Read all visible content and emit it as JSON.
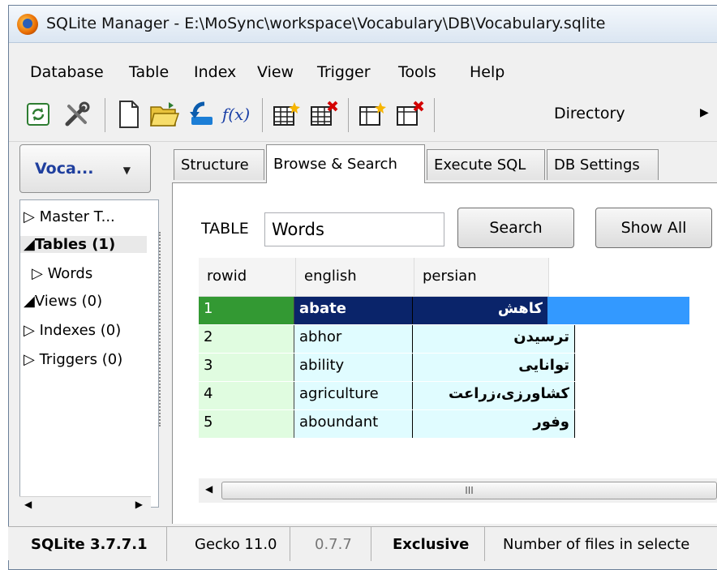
{
  "window": {
    "title": "SQLite Manager - E:\\MoSync\\workspace\\Vocabulary\\DB\\Vocabulary.sqlite"
  },
  "menu": [
    "Database",
    "Table",
    "Index",
    "View",
    "Trigger",
    "Tools",
    "Help"
  ],
  "toolbar": {
    "directory_label": "Directory",
    "fx_label": "f(x)"
  },
  "sidebar": {
    "db_selector": "Voca...",
    "tree": [
      {
        "label": "▷ Master T..."
      },
      {
        "label": "◢Tables (1)"
      },
      {
        "label": "▷ Words"
      },
      {
        "label": "◢Views (0)"
      },
      {
        "label": "▷ Indexes (0)"
      },
      {
        "label": "▷ Triggers (0)"
      }
    ]
  },
  "tabs": [
    "Structure",
    "Browse & Search",
    "Execute SQL",
    "DB Settings"
  ],
  "browse": {
    "table_label": "TABLE",
    "table_value": "Words",
    "search_button": "Search",
    "show_all_button": "Show All"
  },
  "grid": {
    "columns": [
      "rowid",
      "english",
      "persian"
    ],
    "rows": [
      {
        "rowid": "1",
        "english": "abate",
        "persian": "کاهش"
      },
      {
        "rowid": "2",
        "english": "abhor",
        "persian": "ترسیدن"
      },
      {
        "rowid": "3",
        "english": "ability",
        "persian": "توانایی"
      },
      {
        "rowid": "4",
        "english": "agriculture",
        "persian": "کشاورزی،زراعت"
      },
      {
        "rowid": "5",
        "english": "aboundant",
        "persian": "وفور"
      }
    ],
    "scroll_grip": "III"
  },
  "statusbar": {
    "sqlite": "SQLite 3.7.7.1",
    "gecko": "Gecko 11.0",
    "version": "0.7.7",
    "mode": "Exclusive",
    "message": "Number of files in selecte"
  }
}
